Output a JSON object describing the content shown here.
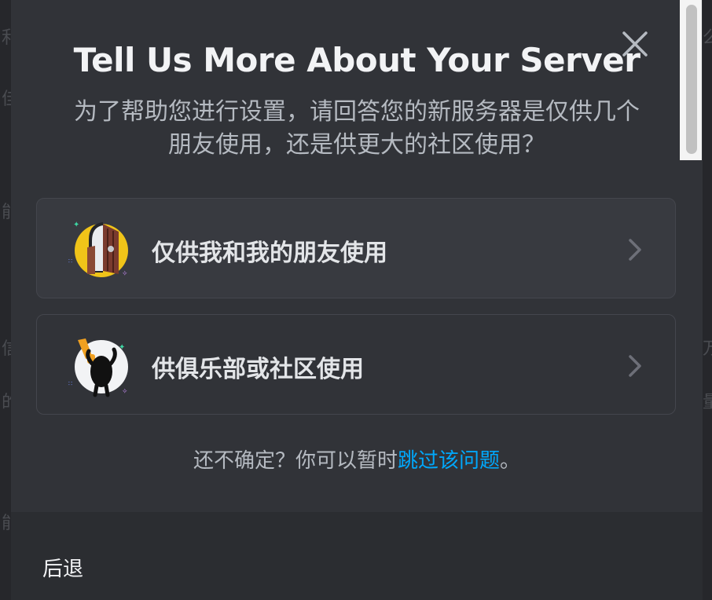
{
  "modal": {
    "title": "Tell Us More About Your Server",
    "subtitle_line1": "为了帮助您进行设置，请回答您的新服务器是仅供几个",
    "subtitle_line2": "朋友使用，还是供更大的社区使用？",
    "options": [
      {
        "label": "仅供我和我的朋友使用",
        "icon": "friends-door-icon"
      },
      {
        "label": "供俱乐部或社区使用",
        "icon": "community-flag-icon"
      }
    ],
    "skip_prefix": "还不确定？你可以暂时",
    "skip_link": "跳过该问题",
    "skip_suffix": "。",
    "back_label": "后退"
  },
  "colors": {
    "modal_bg": "#313338",
    "footer_bg": "#2b2d31",
    "link": "#00a8fc",
    "text_primary": "#f2f3f5",
    "text_secondary": "#b5bac1"
  }
}
